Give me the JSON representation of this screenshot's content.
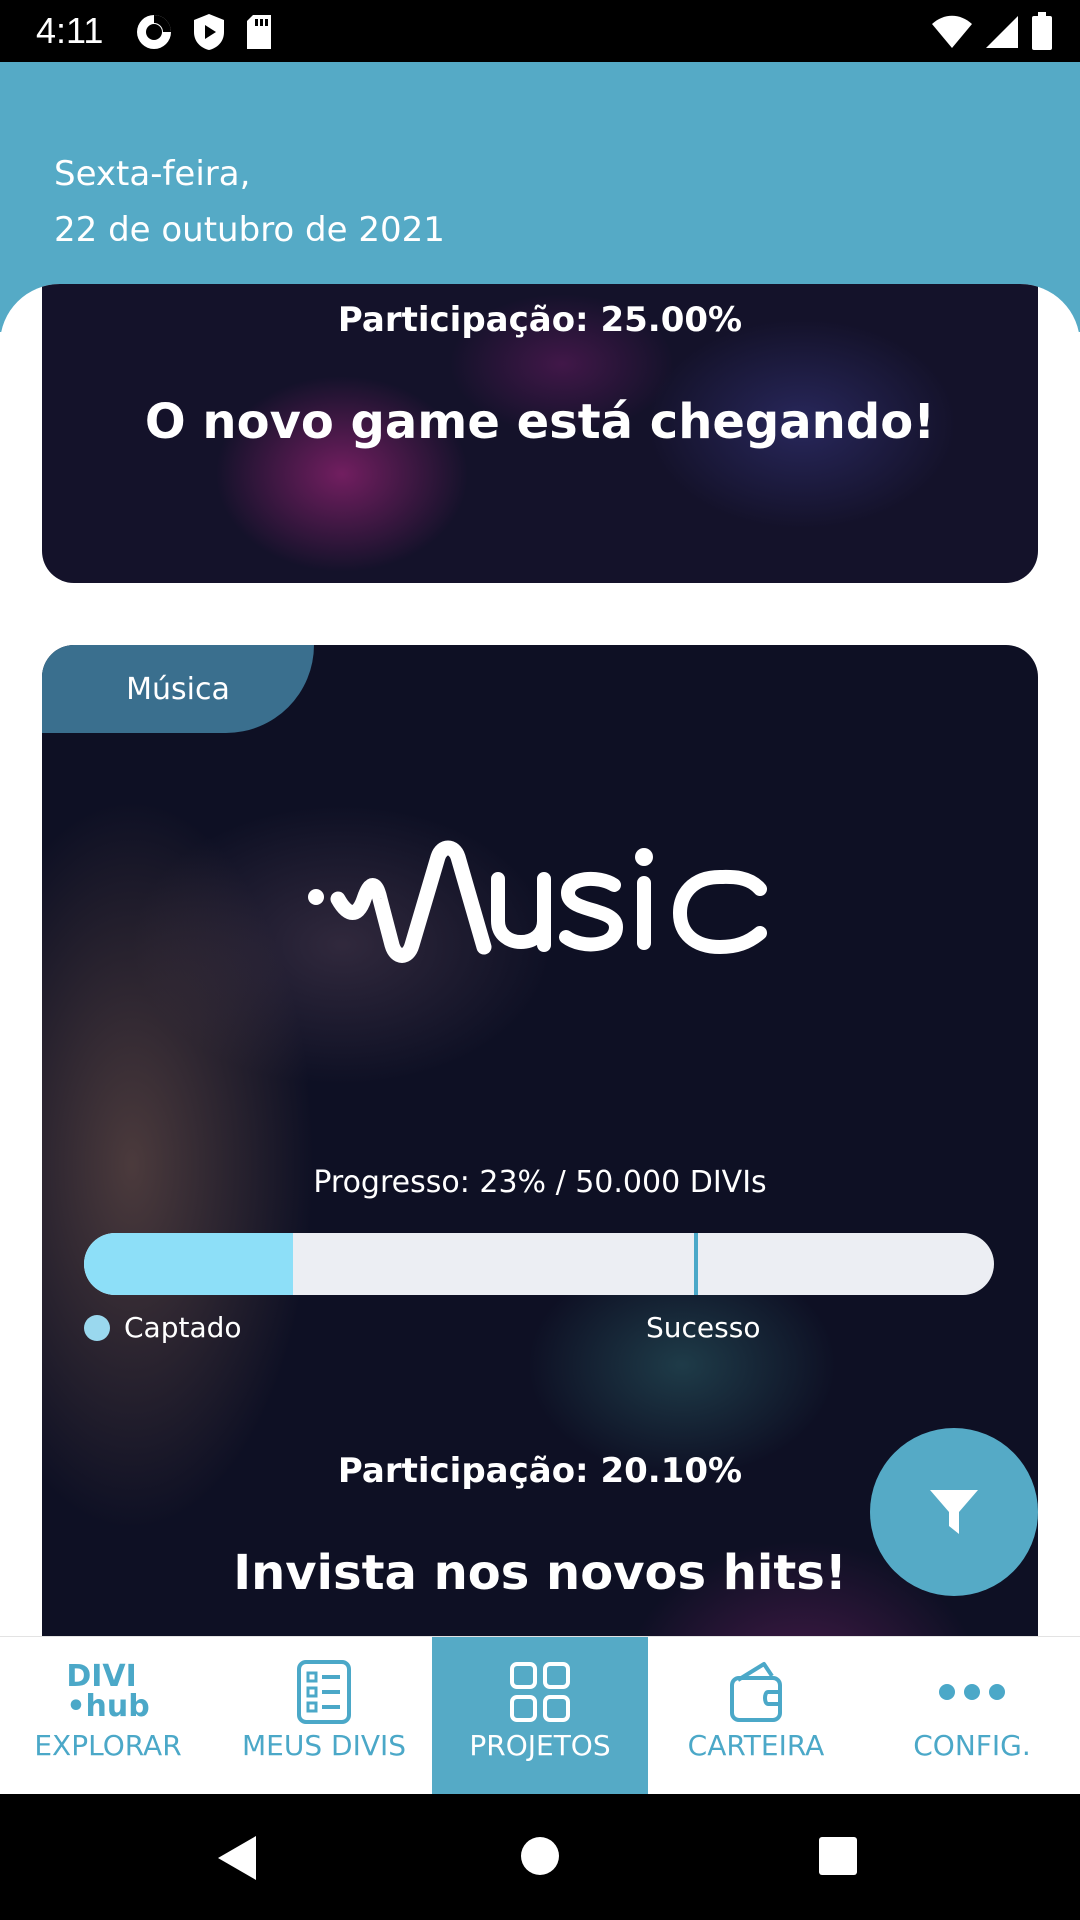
{
  "status_bar": {
    "time": "4:11"
  },
  "header": {
    "day": "Sexta-feira,",
    "date": "22 de outubro de 2021"
  },
  "cards": [
    {
      "participation": "Participação: 25.00%",
      "headline": "O novo game está chegando!"
    },
    {
      "category": "Música",
      "logo_text": "Music",
      "progress_label": "Progresso: 23% / 50.000 DIVIs",
      "progress_value": 0.23,
      "success_marker_value": 0.67,
      "legend": {
        "raised": "Captado",
        "success": "Sucesso"
      },
      "participation": "Participação: 20.10%",
      "headline": "Invista nos novos hits!"
    }
  ],
  "fab": {
    "icon": "filter-icon"
  },
  "bottom_nav": {
    "logo": {
      "line1": "DIVI",
      "line2": "•hub"
    },
    "items": [
      {
        "label": "EXPLORAR",
        "icon": "divihub-logo",
        "active": false
      },
      {
        "label": "MEUS DIVIS",
        "icon": "list-icon",
        "active": false
      },
      {
        "label": "PROJETOS",
        "icon": "grid-icon",
        "active": true
      },
      {
        "label": "CARTEIRA",
        "icon": "wallet-icon",
        "active": false
      },
      {
        "label": "CONFIG.",
        "icon": "more-icon",
        "active": false
      }
    ]
  },
  "colors": {
    "primary": "#55aac6",
    "progress_fill": "#8ddff8",
    "tag": "#3a6f8e"
  }
}
